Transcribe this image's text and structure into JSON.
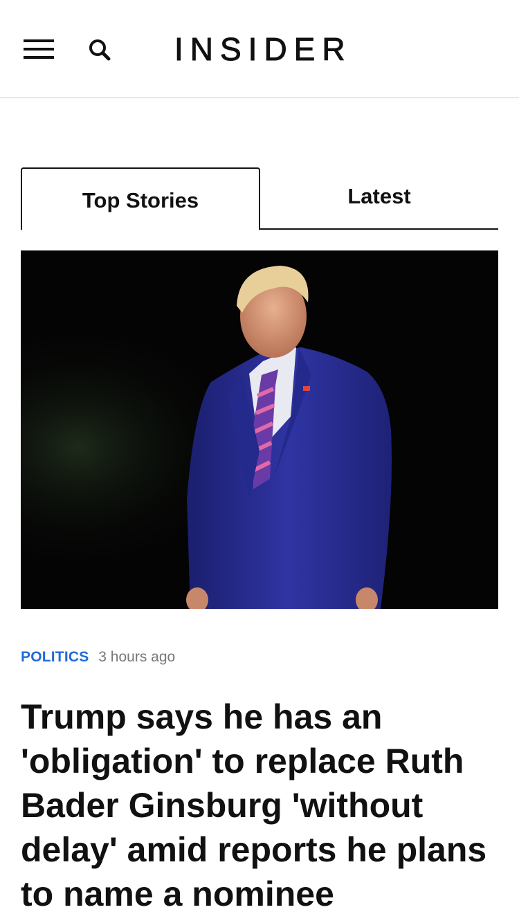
{
  "header": {
    "logo_text": "INSIDER",
    "menu_icon": "hamburger-menu-icon",
    "search_icon": "search-icon"
  },
  "tabs": [
    {
      "label": "Top Stories",
      "active": true
    },
    {
      "label": "Latest",
      "active": false
    }
  ],
  "article": {
    "category": "POLITICS",
    "time_ago": "3 hours ago",
    "headline": "Trump says he has an 'obligation' to replace Ruth Bader Ginsburg 'without delay' amid reports he plans to name a nominee",
    "image": "photo-man-in-blue-suit-at-night"
  },
  "colors": {
    "category": "#1f6bd6",
    "text": "#111111",
    "muted": "#777777",
    "divider": "#e6e6e6"
  }
}
